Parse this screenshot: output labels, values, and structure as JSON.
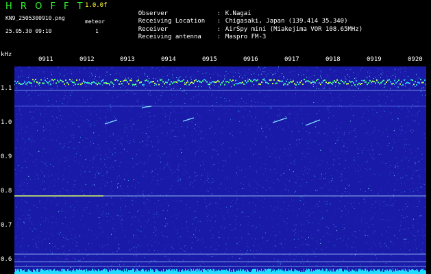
{
  "header": {
    "app_title": "H R O F F T",
    "version": "1.0.0f",
    "filename": "KN9_2505300910.png",
    "datetime": "25.05.30 09:10",
    "mode_label": "meteor",
    "mode_value": "1"
  },
  "info": [
    {
      "key": "Observer",
      "value": "K.Nagai"
    },
    {
      "key": "Receiving Location",
      "value": "Chigasaki, Japan (139.414 35.340)"
    },
    {
      "key": "Receiver",
      "value": "AirSpy mini (Miakejima VOR 108.65MHz)"
    },
    {
      "key": "Receiving antenna",
      "value": "Maspro FM-3"
    }
  ],
  "axes": {
    "unit": "kHz",
    "y_labels": [
      "1.1",
      "1.0",
      "0.9",
      "0.8",
      "0.7",
      "0.6"
    ],
    "time_labels": [
      "0911",
      "0912",
      "0913",
      "0914",
      "0915",
      "0916",
      "0917",
      "0918",
      "0919",
      "0920"
    ]
  },
  "colors": {
    "background": "#000000",
    "plot_background": "#1a1aa8",
    "title_green": "#33ff33",
    "version_yellow": "#ffff33",
    "noise_cyan": "#22ddff"
  }
}
